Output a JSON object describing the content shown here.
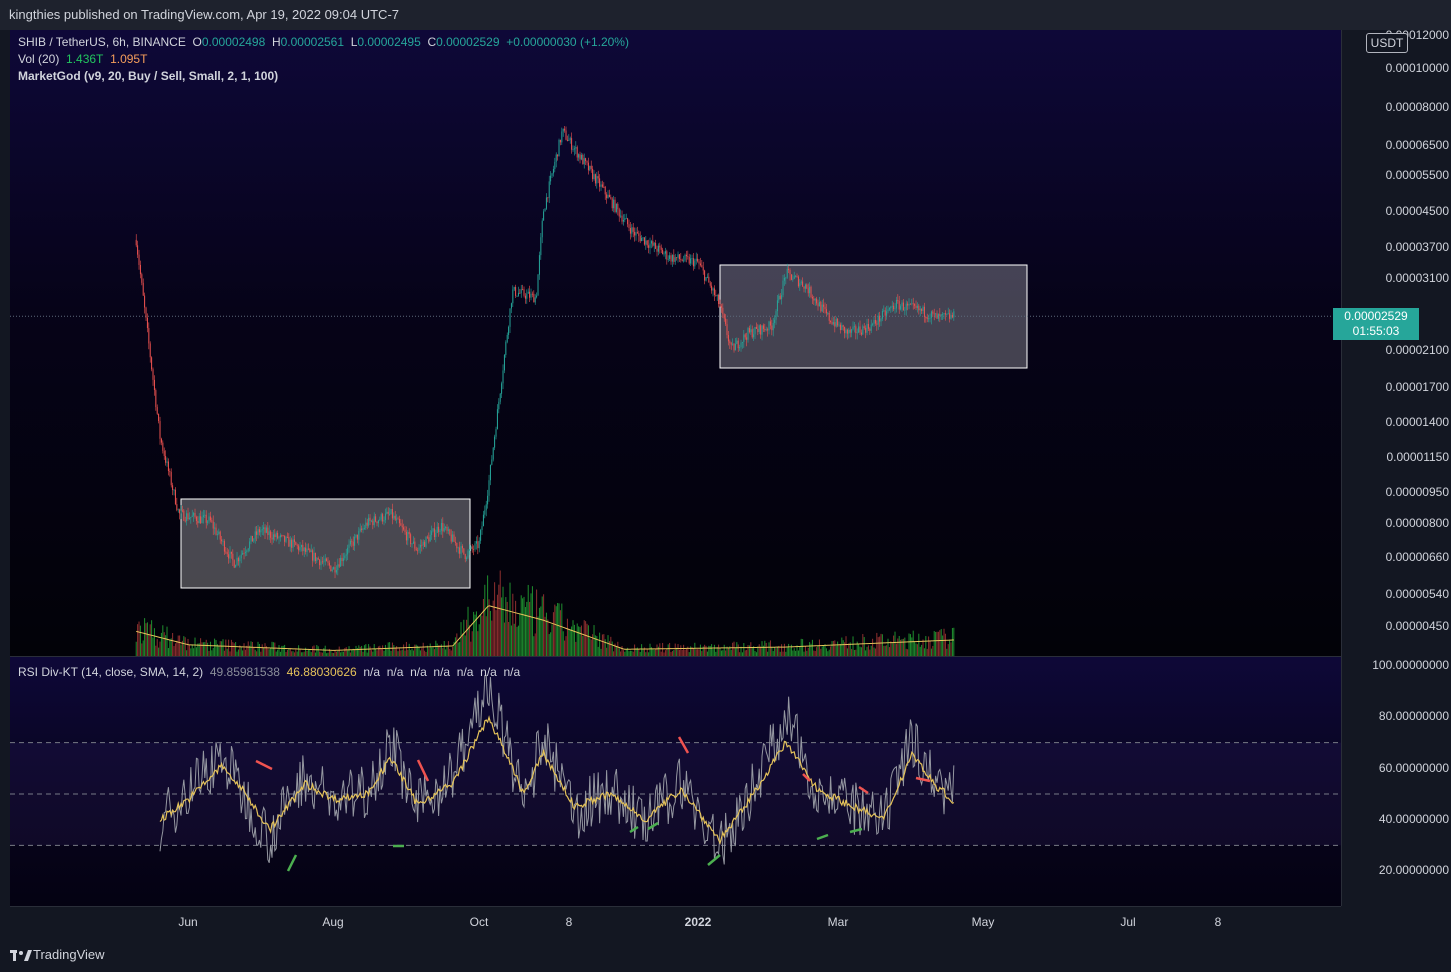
{
  "header": {
    "published_text": "kingthies published on TradingView.com, Apr 19, 2022 09:04 UTC-7"
  },
  "legend": {
    "symbol": "SHIB / TetherUS, 6h, BINANCE",
    "o_label": "O",
    "o_value": "0.00002498",
    "h_label": "H",
    "h_value": "0.00002561",
    "l_label": "L",
    "l_value": "0.00002495",
    "c_label": "C",
    "c_value": "0.00002529",
    "change": "+0.00000030 (+1.20%)",
    "vol_label": "Vol (20)",
    "vol_value1": "1.436T",
    "vol_value2": "1.095T",
    "marketgod": "MarketGod (v9, 20, Buy / Sell, Small, 2, 1, 100)",
    "rsi_label": "RSI Div-KT (14, close, SMA, 14, 2)",
    "rsi_value1": "49.85981538",
    "rsi_value2": "46.88030626",
    "rsi_na": [
      "n/a",
      "n/a",
      "n/a",
      "n/a",
      "n/a",
      "n/a",
      "n/a"
    ]
  },
  "currency_button": "USDT",
  "current_price": {
    "price": "0.00002529",
    "countdown": "01:55:03",
    "color": "#26a69a"
  },
  "price_axis_labels": [
    "0.00012000",
    "0.00010000",
    "0.00008000",
    "0.00006500",
    "0.00005500",
    "0.00004500",
    "0.00003700",
    "0.00003100",
    "0.00002100",
    "0.00001700",
    "0.00001400",
    "0.00001150",
    "0.00000950",
    "0.00000800",
    "0.00000660",
    "0.00000540",
    "0.00000450"
  ],
  "rsi_axis_labels": [
    "100.00000000",
    "80.00000000",
    "60.00000000",
    "40.00000000",
    "20.00000000"
  ],
  "x_axis_labels": [
    "Jun",
    "Aug",
    "Oct",
    "8",
    "2022",
    "Mar",
    "May",
    "Jul",
    "8"
  ],
  "branding": {
    "logo_text": "TradingView"
  },
  "colors": {
    "up": "#26a69a",
    "down": "#ef5350",
    "rsi_line": "#9598a1",
    "rsi_ma": "#e5c35a",
    "bull_div": "#4caf50",
    "bear_div": "#ef5350",
    "box_border": "#ffffff"
  },
  "chart_data": [
    {
      "type": "line",
      "title": "SHIB / TetherUS, 6h, BINANCE",
      "scale": "log",
      "x": [
        "2021-05-10",
        "2021-05-20",
        "2021-05-28",
        "2021-06-10",
        "2021-06-20",
        "2021-07-01",
        "2021-07-15",
        "2021-08-01",
        "2021-08-15",
        "2021-08-25",
        "2021-09-05",
        "2021-09-15",
        "2021-09-25",
        "2021-10-01",
        "2021-10-05",
        "2021-10-15",
        "2021-10-25",
        "2021-10-28",
        "2021-11-05",
        "2021-11-15",
        "2021-11-25",
        "2021-12-05",
        "2021-12-20",
        "2022-01-01",
        "2022-01-10",
        "2022-01-15",
        "2022-01-22",
        "2022-02-01",
        "2022-02-07",
        "2022-02-15",
        "2022-02-25",
        "2022-03-05",
        "2022-03-15",
        "2022-03-25",
        "2022-04-05",
        "2022-04-12",
        "2022-04-19"
      ],
      "series": [
        {
          "values": [
            3.85e-05,
            1.3e-05,
            8.5e-06,
            8.2e-06,
            6.5e-06,
            7.8e-06,
            7.2e-06,
            6.3e-06,
            8.1e-06,
            8.5e-06,
            7e-06,
            8e-06,
            6.8e-06,
            7.2e-06,
            1e-05,
            2.9e-05,
            2.8e-05,
            4.5e-05,
            7e-05,
            5.8e-05,
            4.8e-05,
            4e-05,
            3.5e-05,
            3.4e-05,
            2.7e-05,
            2.1e-05,
            2.3e-05,
            2.4e-05,
            3.2e-05,
            3e-05,
            2.5e-05,
            2.3e-05,
            2.4e-05,
            2.7e-05,
            2.6e-05,
            2.5e-05,
            2.529e-05
          ]
        }
      ],
      "ylim": [
        4e-06,
        0.000122
      ]
    },
    {
      "type": "bar",
      "title": "Vol (20)",
      "x": [
        "2021-05-10",
        "2021-06-01",
        "2021-08-01",
        "2021-09-20",
        "2021-10-05",
        "2021-10-28",
        "2021-12-01",
        "2022-02-07",
        "2022-04-19"
      ],
      "values": [
        2.2,
        1.0,
        0.5,
        0.9,
        4.5,
        3.2,
        0.6,
        0.8,
        1.436
      ]
    },
    {
      "type": "line",
      "title": "RSI Div-KT (14, close, SMA, 14, 2)",
      "ylim": [
        10,
        100
      ],
      "levels": [
        70,
        50,
        30
      ],
      "x": [
        "2021-05-20",
        "2021-06-01",
        "2021-06-15",
        "2021-06-25",
        "2021-07-05",
        "2021-07-20",
        "2021-08-01",
        "2021-08-15",
        "2021-08-25",
        "2021-09-05",
        "2021-09-20",
        "2021-10-05",
        "2021-10-20",
        "2021-10-28",
        "2021-11-10",
        "2021-11-25",
        "2021-12-10",
        "2021-12-25",
        "2022-01-10",
        "2022-01-20",
        "2022-02-07",
        "2022-02-20",
        "2022-03-05",
        "2022-03-20",
        "2022-04-01",
        "2022-04-10",
        "2022-04-19"
      ],
      "series": [
        {
          "values": [
            38,
            52,
            65,
            48,
            33,
            58,
            46,
            52,
            70,
            44,
            58,
            92,
            46,
            72,
            42,
            52,
            38,
            55,
            28,
            45,
            80,
            52,
            45,
            38,
            72,
            55,
            49.86
          ]
        },
        {
          "values": [
            40,
            48,
            61,
            50,
            36,
            54,
            48,
            50,
            64,
            46,
            54,
            80,
            50,
            66,
            45,
            50,
            40,
            52,
            32,
            44,
            70,
            52,
            46,
            40,
            66,
            54,
            46.88
          ]
        }
      ]
    }
  ]
}
